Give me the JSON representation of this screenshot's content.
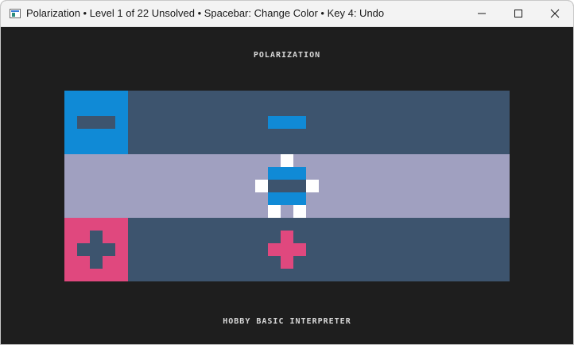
{
  "window": {
    "title": "Polarization  •  Level 1 of 22 Unsolved  •  Spacebar: Change Color  •  Key 4: Undo",
    "controls": [
      "minimize",
      "maximize",
      "close"
    ]
  },
  "game": {
    "title": "POLARIZATION",
    "footer": "HOBBY BASIC INTERPRETER",
    "colors": {
      "background": "#1e1e1e",
      "row_dark": "#3d546e",
      "row_light": "#a0a0c0",
      "blue": "#108ad6",
      "pink": "#e0487e",
      "white": "#ffffff"
    },
    "rows": [
      {
        "name": "top-row",
        "terminal": "negative",
        "terminal_side": "left",
        "marker": "minus"
      },
      {
        "name": "middle-row",
        "player": "robot"
      },
      {
        "name": "bottom-row",
        "terminal": "positive",
        "terminal_side": "right",
        "marker": "plus"
      }
    ]
  }
}
